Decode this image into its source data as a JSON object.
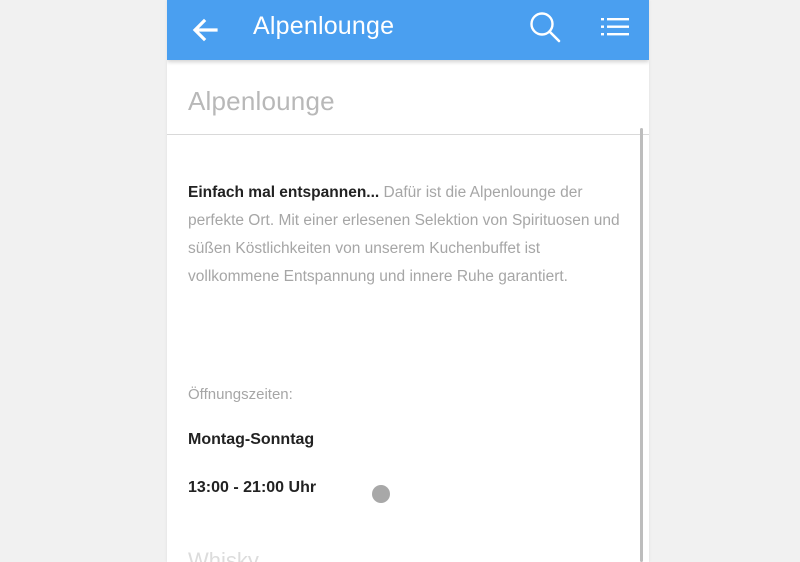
{
  "appbar": {
    "title": "Alpenlounge",
    "back_icon": "arrow-left-icon",
    "search_icon": "search-icon",
    "menu_icon": "list-menu-icon",
    "color": "#4a9ff0"
  },
  "page": {
    "heading": "Alpenlounge",
    "intro_bold": "Einfach mal entspannen...",
    "intro_text": " Dafür ist die Alpenlounge der perfekte Ort. Mit einer erlesenen Selektion von Spirituosen und süßen Köstlichkeiten von unserem Kuchenbuffet ist vollkommene Entspannung und innere Ruhe garantiert.",
    "hours_label": "Öffnungszeiten:",
    "days": "Montag-Sonntag",
    "time": "13:00 - 21:00 Uhr",
    "next_heading": "Whisky"
  }
}
